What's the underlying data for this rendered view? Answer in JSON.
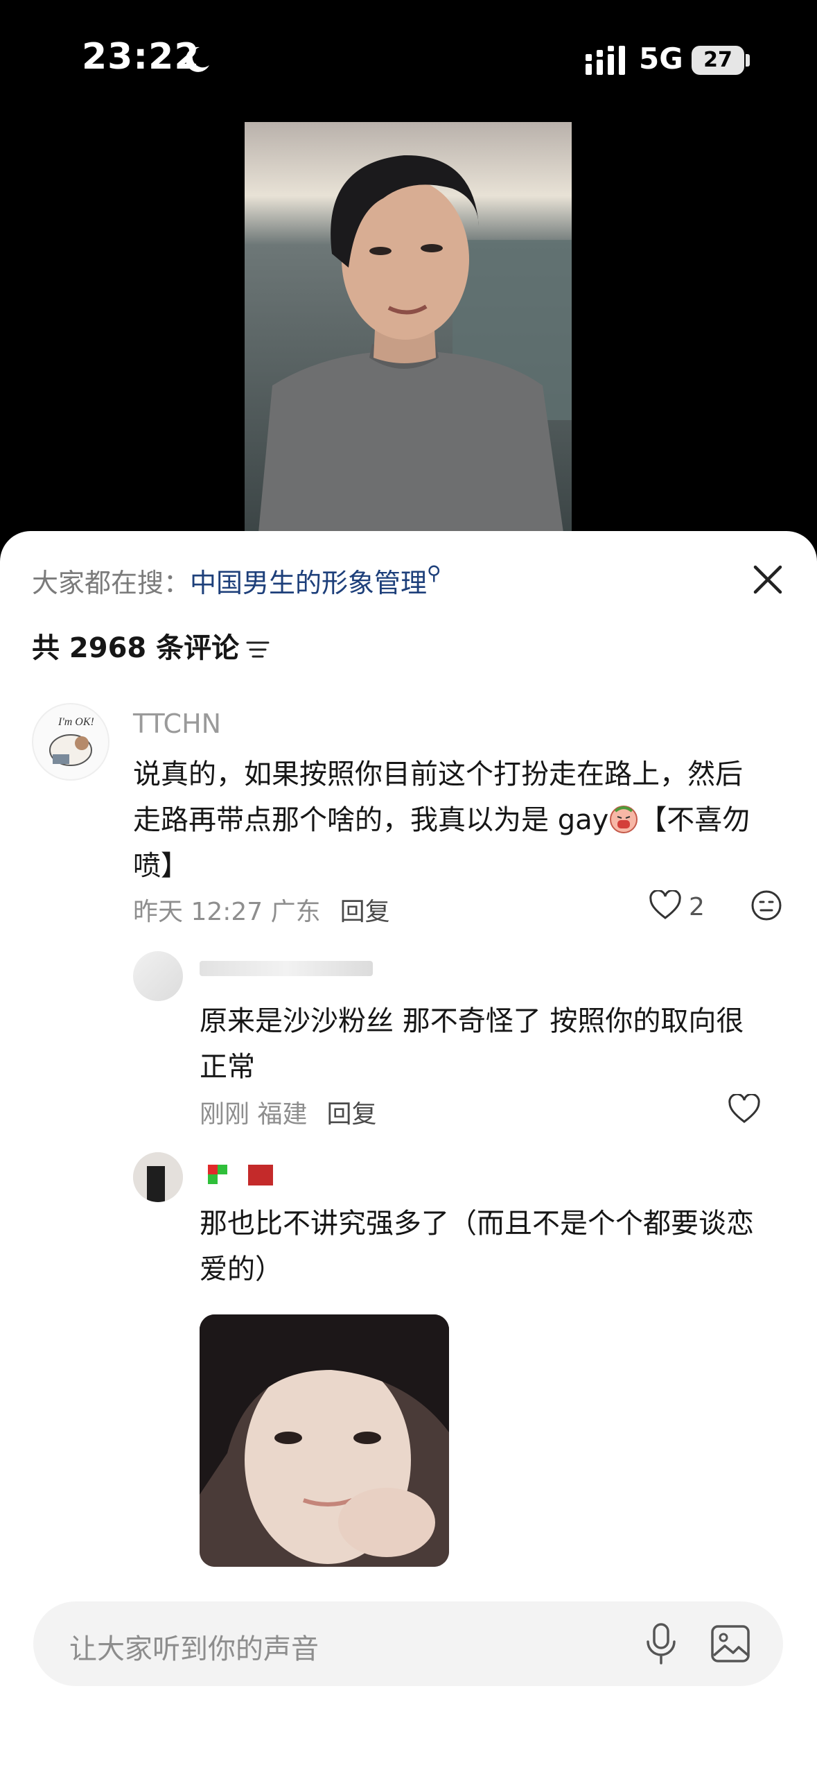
{
  "status_bar": {
    "time": "23:22",
    "network": "5G",
    "battery": "27"
  },
  "video": {
    "alt": ""
  },
  "header": {
    "hot_search_prefix": "大家都在搜：",
    "hot_search_keyword": "中国男生的形象管理",
    "comment_count_label": "共 2968 条评论"
  },
  "comments": [
    {
      "username": "TTCHN",
      "avatar_text": "I'm OK!",
      "text_line1": "说真的，如果按照你目前这个打扮走在路上，然后",
      "text_line2_before": "走路再带点那个啥的，我真以为是 gay",
      "text_line2_after": "【不喜勿",
      "text_line3": "喷】",
      "time": "昨天 12:27 广东",
      "reply_label": "回复",
      "likes": "2"
    },
    {
      "text_line1": "原来是沙沙粉丝 那不奇怪了 按照你的取向很",
      "text_line2": "正常",
      "time": "刚刚 福建",
      "reply_label": "回复"
    },
    {
      "text_line1": "那也比不讲究强多了（而且不是个个都要谈恋",
      "text_line2": "爱的）"
    }
  ],
  "input": {
    "placeholder": "让大家听到你的声音"
  },
  "colors": {
    "link": "#1d3f7a",
    "sheet": "#ffffff",
    "input_bg": "#f3f3f3"
  },
  "icons": [
    "moon-icon",
    "signal-icon",
    "close-icon",
    "filter-icon",
    "heart-icon",
    "emoji-icon",
    "mic-icon",
    "image-icon"
  ]
}
